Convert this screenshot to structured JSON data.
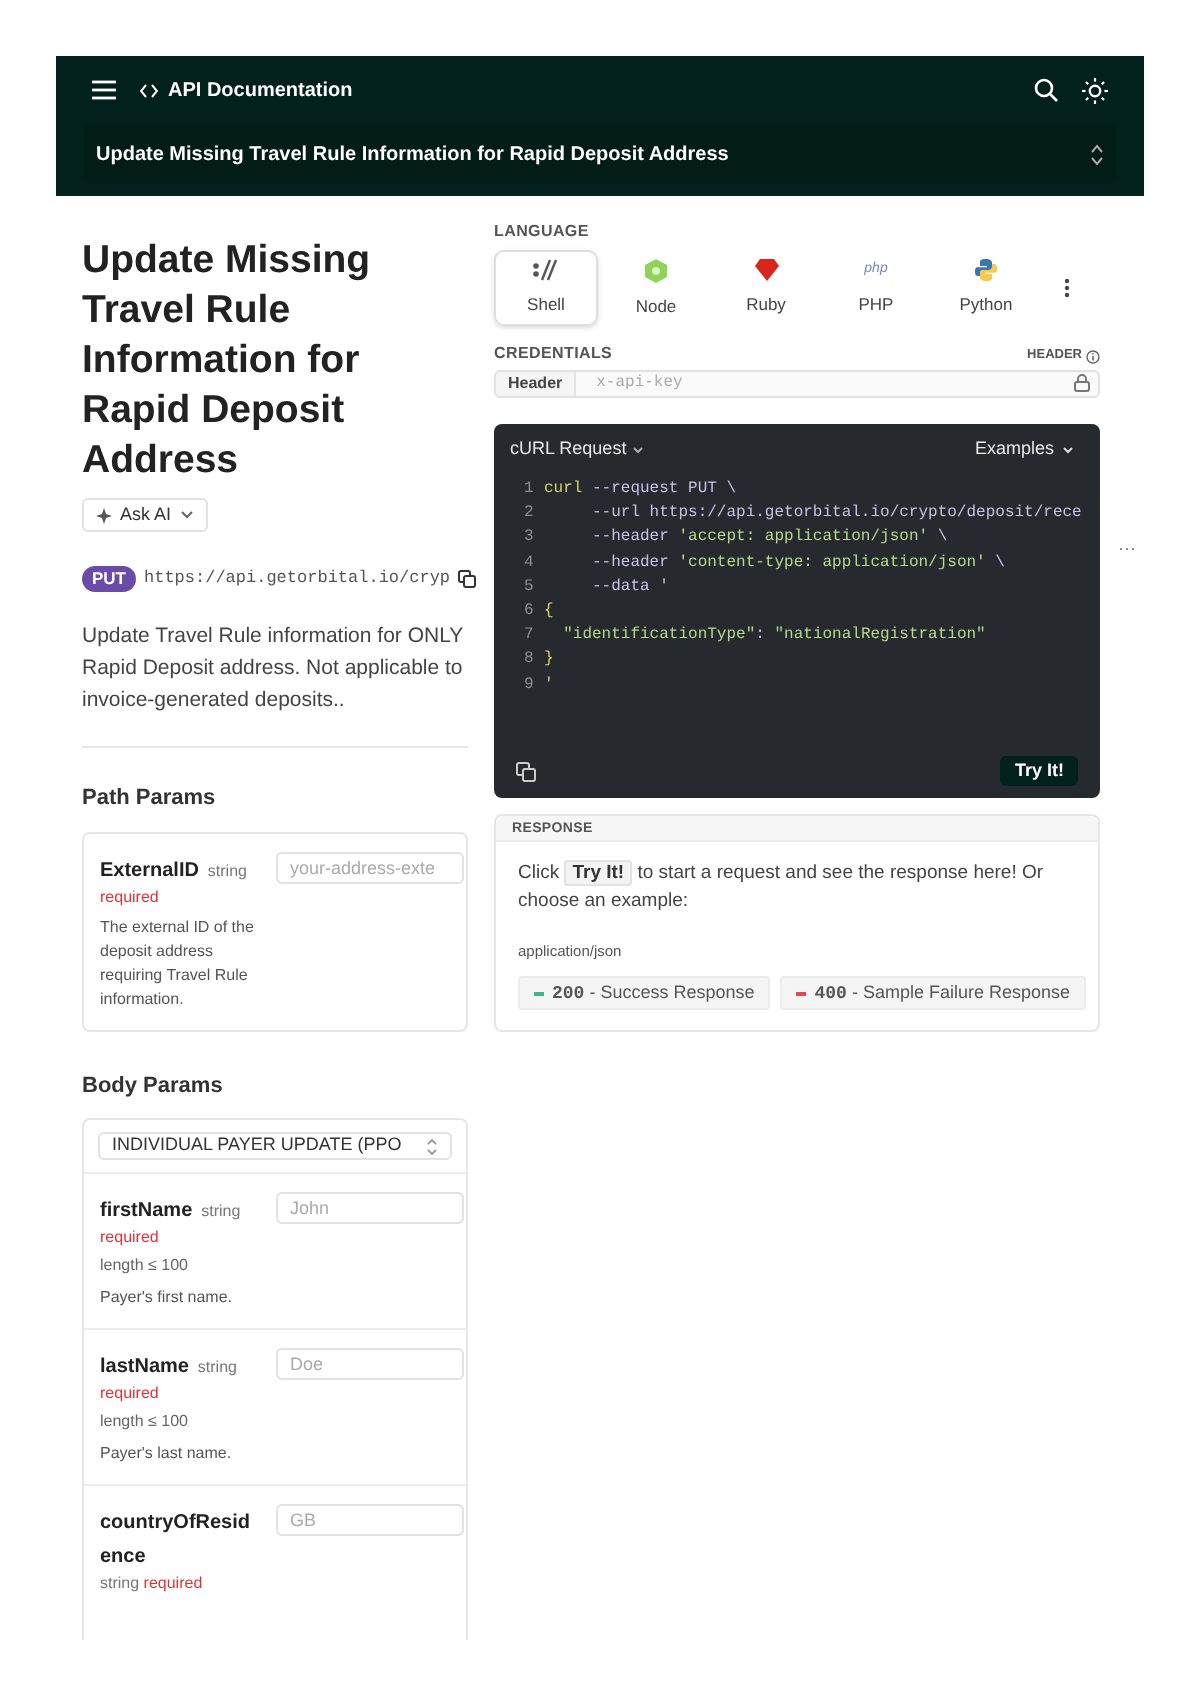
{
  "header": {
    "title": "API Documentation",
    "page_select": "Update Missing Travel Rule Information for Rapid Deposit Address"
  },
  "endpoint": {
    "title": "Update Missing Travel Rule Information for Rapid Deposit Address",
    "ask_ai": "Ask AI",
    "method": "PUT",
    "url": "https://api.getorbital.io/cryp",
    "overflow": "···",
    "description": "Update Travel Rule information for ONLY Rapid Deposit address. Not applicable to invoice-generated deposits.."
  },
  "path_params": {
    "heading": "Path Params",
    "params": [
      {
        "name": "ExternalID",
        "type": "string",
        "required": "required",
        "placeholder": "your-address-exte",
        "description": "The external ID of the deposit address requiring Travel Rule information."
      }
    ]
  },
  "body_params": {
    "heading": "Body Params",
    "variant": "INDIVIDUAL PAYER UPDATE (PPO",
    "params": [
      {
        "name": "firstName",
        "type": "string",
        "required": "required",
        "constraint": "length ≤ 100",
        "placeholder": "John",
        "description": "Payer's first name."
      },
      {
        "name": "lastName",
        "type": "string",
        "required": "required",
        "constraint": "length ≤ 100",
        "placeholder": "Doe",
        "description": "Payer's last name."
      },
      {
        "name": "countryOfResidence",
        "type": "string",
        "required": "required",
        "placeholder": "GB"
      }
    ]
  },
  "language": {
    "label": "LANGUAGE",
    "tabs": [
      {
        "label": "Shell",
        "kind": "shell",
        "selected": true
      },
      {
        "label": "Node",
        "kind": "node",
        "selected": false
      },
      {
        "label": "Ruby",
        "kind": "ruby",
        "selected": false
      },
      {
        "label": "PHP",
        "kind": "php",
        "selected": false
      },
      {
        "label": "Python",
        "kind": "python",
        "selected": false
      }
    ]
  },
  "credentials": {
    "label": "CREDENTIALS",
    "header_label": "HEADER",
    "tab": "Header",
    "placeholder": "x-api-key"
  },
  "request": {
    "title": "cURL Request",
    "examples": "Examples",
    "try_button": "Try It!",
    "lines": [
      {
        "number": "1",
        "segments": [
          {
            "text": "curl",
            "kind": "command"
          },
          {
            "text": " --request PUT \\",
            "kind": "flag"
          }
        ]
      },
      {
        "number": "2",
        "segments": [
          {
            "text": "     --url https://api.getorbital.io/crypto/deposit/rece",
            "kind": "flag"
          }
        ]
      },
      {
        "number": "3",
        "segments": [
          {
            "text": "     --header ",
            "kind": "flag"
          },
          {
            "text": "'accept: application/json'",
            "kind": "string"
          },
          {
            "text": " \\",
            "kind": "flag"
          }
        ]
      },
      {
        "number": "4",
        "segments": [
          {
            "text": "     --header ",
            "kind": "flag"
          },
          {
            "text": "'content-type: application/json'",
            "kind": "string"
          },
          {
            "text": " \\",
            "kind": "flag"
          }
        ]
      },
      {
        "number": "5",
        "segments": [
          {
            "text": "     --data ",
            "kind": "flag"
          },
          {
            "text": "'",
            "kind": "string"
          }
        ]
      },
      {
        "number": "6",
        "segments": [
          {
            "text": "{",
            "kind": "brace"
          }
        ]
      },
      {
        "number": "7",
        "segments": [
          {
            "text": "  \"identificationType\"",
            "kind": "string"
          },
          {
            "text": ": ",
            "kind": "flag"
          },
          {
            "text": "\"nationalRegistration\"",
            "kind": "string"
          }
        ]
      },
      {
        "number": "8",
        "segments": [
          {
            "text": "}",
            "kind": "brace"
          }
        ]
      },
      {
        "number": "9",
        "segments": [
          {
            "text": "'",
            "kind": "string"
          }
        ]
      }
    ]
  },
  "response": {
    "label": "RESPONSE",
    "text_before": "Click",
    "inline_button": "Try It!",
    "text_after": "to start a request and see the response here! Or choose an example:",
    "content_type": "application/json",
    "examples": [
      {
        "code": "200",
        "label": " - Success Response",
        "color": "#3fb68b"
      },
      {
        "code": "400",
        "label": " - Sample Failure Response",
        "color": "#e5484d"
      }
    ]
  }
}
